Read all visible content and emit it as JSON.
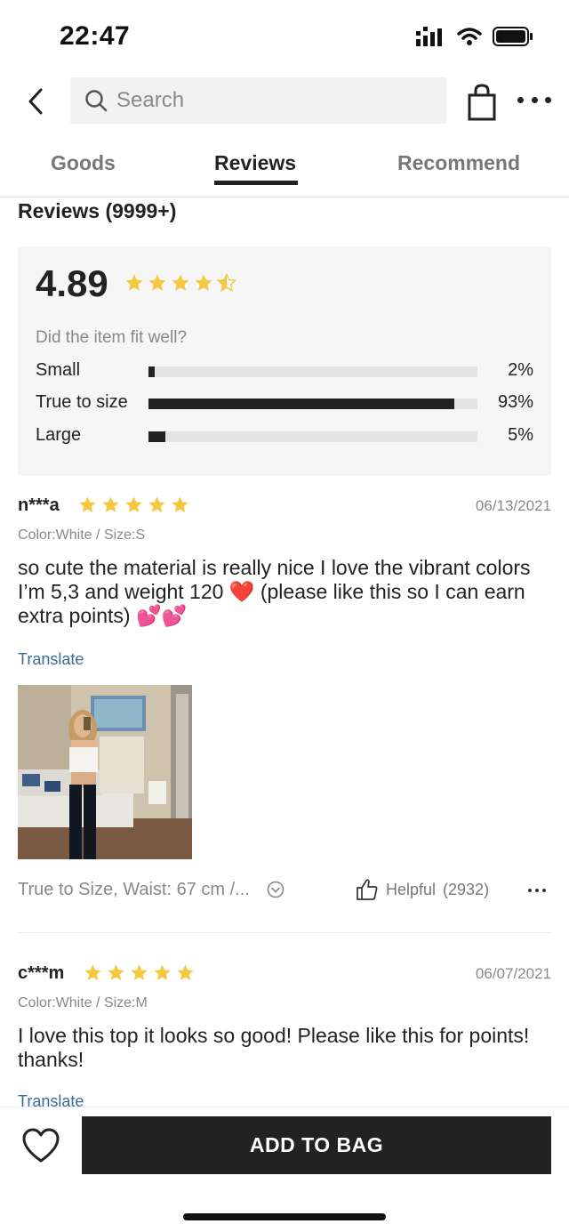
{
  "status_bar": {
    "time": "22:47"
  },
  "nav": {
    "search_placeholder": "Search",
    "icons": [
      "back-arrow-icon",
      "search-icon",
      "shopping-bag-icon",
      "more-icon"
    ]
  },
  "tabs": [
    {
      "label": "Goods",
      "active": false
    },
    {
      "label": "Reviews",
      "active": true
    },
    {
      "label": "Recommend",
      "active": false
    }
  ],
  "reviews_header": "Reviews (9999+)",
  "rating": {
    "score": "4.89",
    "stars": 4.89,
    "fit_question": "Did the item fit well?",
    "fit": [
      {
        "label": "Small",
        "percent_text": "2%",
        "value": 0.02
      },
      {
        "label": "True to size",
        "percent_text": "93%",
        "value": 0.93
      },
      {
        "label": "Large",
        "percent_text": "5%",
        "value": 0.05
      }
    ]
  },
  "reviews": [
    {
      "user": "n***a",
      "stars": 5,
      "date": "06/13/2021",
      "variant": "Color:White / Size:S",
      "text": "so cute the material is really nice I love the vibrant colors I’m 5,3 and weight 120 ❤️ (please like this so I can earn extra points) 💕💕",
      "translate": "Translate",
      "fit_summary": "True to Size, Waist: 67 cm /...",
      "helpful_label": "Helpful",
      "helpful_count": "(2932)"
    },
    {
      "user": "c***m",
      "stars": 5,
      "date": "06/07/2021",
      "variant": "Color:White / Size:M",
      "text": "I love this top it looks so good! Please like this for points! thanks!",
      "translate": "Translate"
    }
  ],
  "bottom": {
    "add_to_bag": "ADD TO BAG"
  },
  "colors": {
    "star": "#f5c842",
    "primary": "#222222",
    "link": "#3a6a9a"
  }
}
